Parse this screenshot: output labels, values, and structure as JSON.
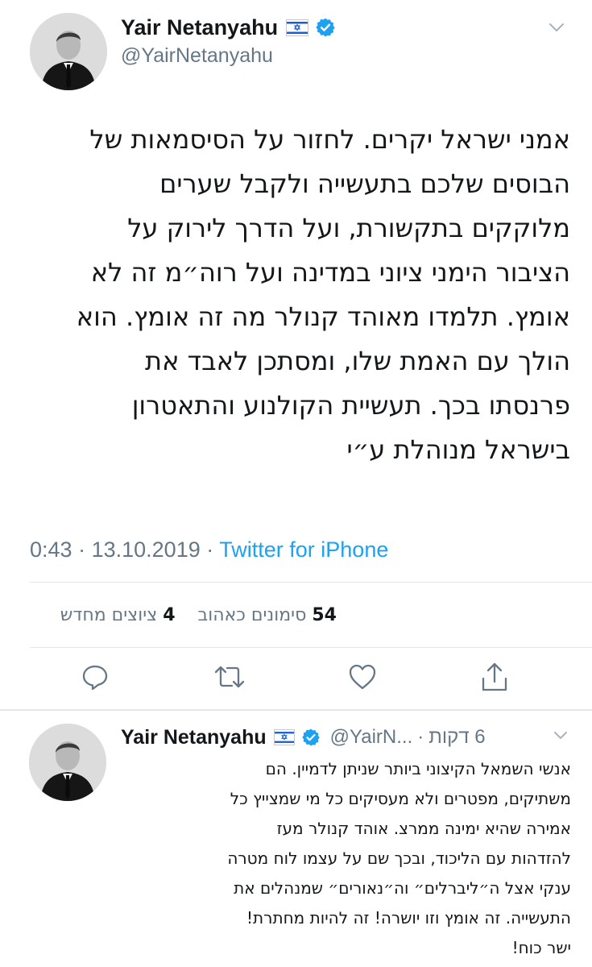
{
  "main_tweet": {
    "author_name": "Yair Netanyahu",
    "handle": "@YairNetanyahu",
    "lines": [
      "אמני ישראל יקרים. לחזור על הסיסמאות של",
      "הבוסים שלכם בתעשייה ולקבל שערים",
      "מלוקקים בתקשורת, ועל הדרך לירוק על",
      "הציבור הימני ציוני במדינה ועל רוה״מ זה לא",
      "אומץ. תלמדו מאוהד קנולר מה זה אומץ. הוא",
      "הולך עם האמת שלו, ומסתכן לאבד את",
      "פרנסתו בכך. תעשיית הקולנוע והתאטרון",
      "בישראל מנוהלת ע״י"
    ],
    "time": "0:43",
    "date": "13.10.2019",
    "separator": "·",
    "source": "Twitter for iPhone",
    "likes_count": "54",
    "likes_label": "סימונים כאהוב",
    "retweets_count": "4",
    "retweets_label": "ציוצים מחדש"
  },
  "reply_tweet": {
    "author_name": "Yair Netanyahu",
    "handle": "@YairN...",
    "separator": "·",
    "time_ago": "6 דקות",
    "lines": [
      "אנשי השמאל הקיצוני ביותר שניתן לדמיין. הם",
      "משתיקים, מפטרים ולא מעסיקים כל מי שמצייץ כל",
      "אמירה שהיא ימינה ממרצ. אוהד קנולר מעז",
      "להזדהות עם הליכוד, ובכך שם על עצמו לוח מטרה",
      "ענקי אצל ה״ליברלים״ וה״נאורים״ שמנהלים את",
      "התעשייה. זה אומץ וזו יושרה! זה להיות מחתרת!",
      "ישר כוח!"
    ]
  },
  "icons": {
    "verified": "verified-badge-icon",
    "flag": "israel-flag-icon",
    "chevron": "chevron-down-icon",
    "reply": "reply-icon",
    "retweet": "retweet-icon",
    "like": "heart-icon",
    "share": "share-icon"
  },
  "colors": {
    "link_blue": "#1da1f2",
    "muted": "#657786",
    "text": "#14171a",
    "divider": "#e1e8ed"
  }
}
